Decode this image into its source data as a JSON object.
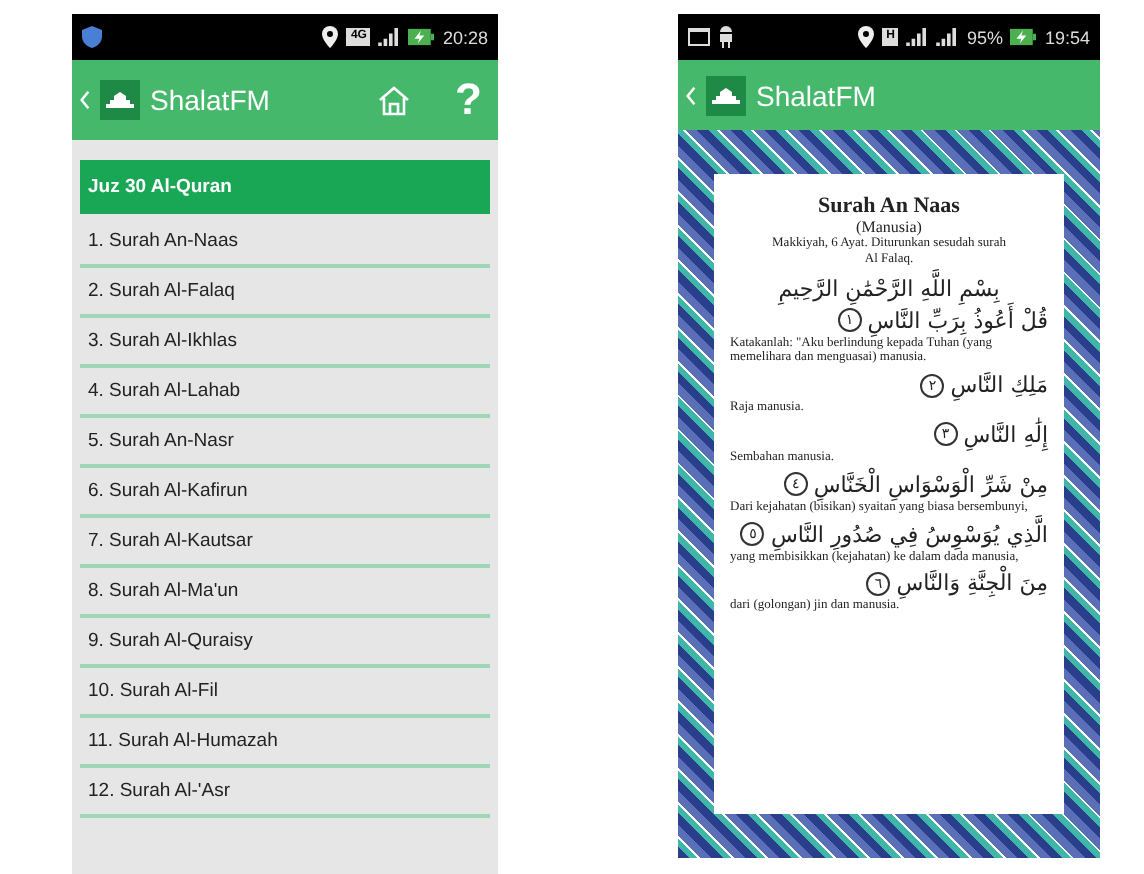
{
  "left_screen": {
    "status_bar": {
      "network": "4G",
      "time": "20:28"
    },
    "app_bar": {
      "title": "ShalatFM",
      "help": "?"
    },
    "list": {
      "header": "Juz 30 Al-Quran",
      "items": [
        "1. Surah An-Naas",
        "2. Surah Al-Falaq",
        "3. Surah Al-Ikhlas",
        "4. Surah Al-Lahab",
        "5. Surah An-Nasr",
        "6. Surah Al-Kafirun",
        "7. Surah Al-Kautsar",
        "8. Surah Al-Ma'un",
        "9. Surah Al-Quraisy",
        "10. Surah Al-Fil",
        "11. Surah Al-Humazah",
        "12. Surah Al-'Asr"
      ]
    }
  },
  "right_screen": {
    "status_bar": {
      "network": "H",
      "battery": "95%",
      "time": "19:54"
    },
    "app_bar": {
      "title": "ShalatFM"
    },
    "surah": {
      "title": "Surah An Naas",
      "meaning": "(Manusia)",
      "info": "Makkiyah, 6 Ayat. Diturunkan sesudah surah Al Falaq.",
      "basmala": "بِسْمِ اللَّهِ الرَّحْمَٰنِ الرَّحِيمِ",
      "verses": [
        {
          "arabic": "قُلْ أَعُوذُ بِرَبِّ النَّاسِ",
          "number": "١",
          "translation": "Katakanlah: \"Aku berlindung kepada Tuhan (yang memelihara dan menguasai) manusia."
        },
        {
          "arabic": "مَلِكِ النَّاسِ",
          "number": "٢",
          "translation": "Raja manusia."
        },
        {
          "arabic": "إِلَٰهِ النَّاسِ",
          "number": "٣",
          "translation": "Sembahan manusia."
        },
        {
          "arabic": "مِنْ شَرِّ الْوَسْوَاسِ الْخَنَّاسِ",
          "number": "٤",
          "translation": "Dari kejahatan (bisikan) syaitan yang biasa bersembunyi,"
        },
        {
          "arabic": "الَّذِي يُوَسْوِسُ فِي صُدُورِ النَّاسِ",
          "number": "٥",
          "translation": "yang membisikkan (kejahatan) ke dalam dada manusia,"
        },
        {
          "arabic": "مِنَ الْجِنَّةِ وَالنَّاسِ",
          "number": "٦",
          "translation": "dari (golongan) jin dan manusia."
        }
      ]
    }
  }
}
